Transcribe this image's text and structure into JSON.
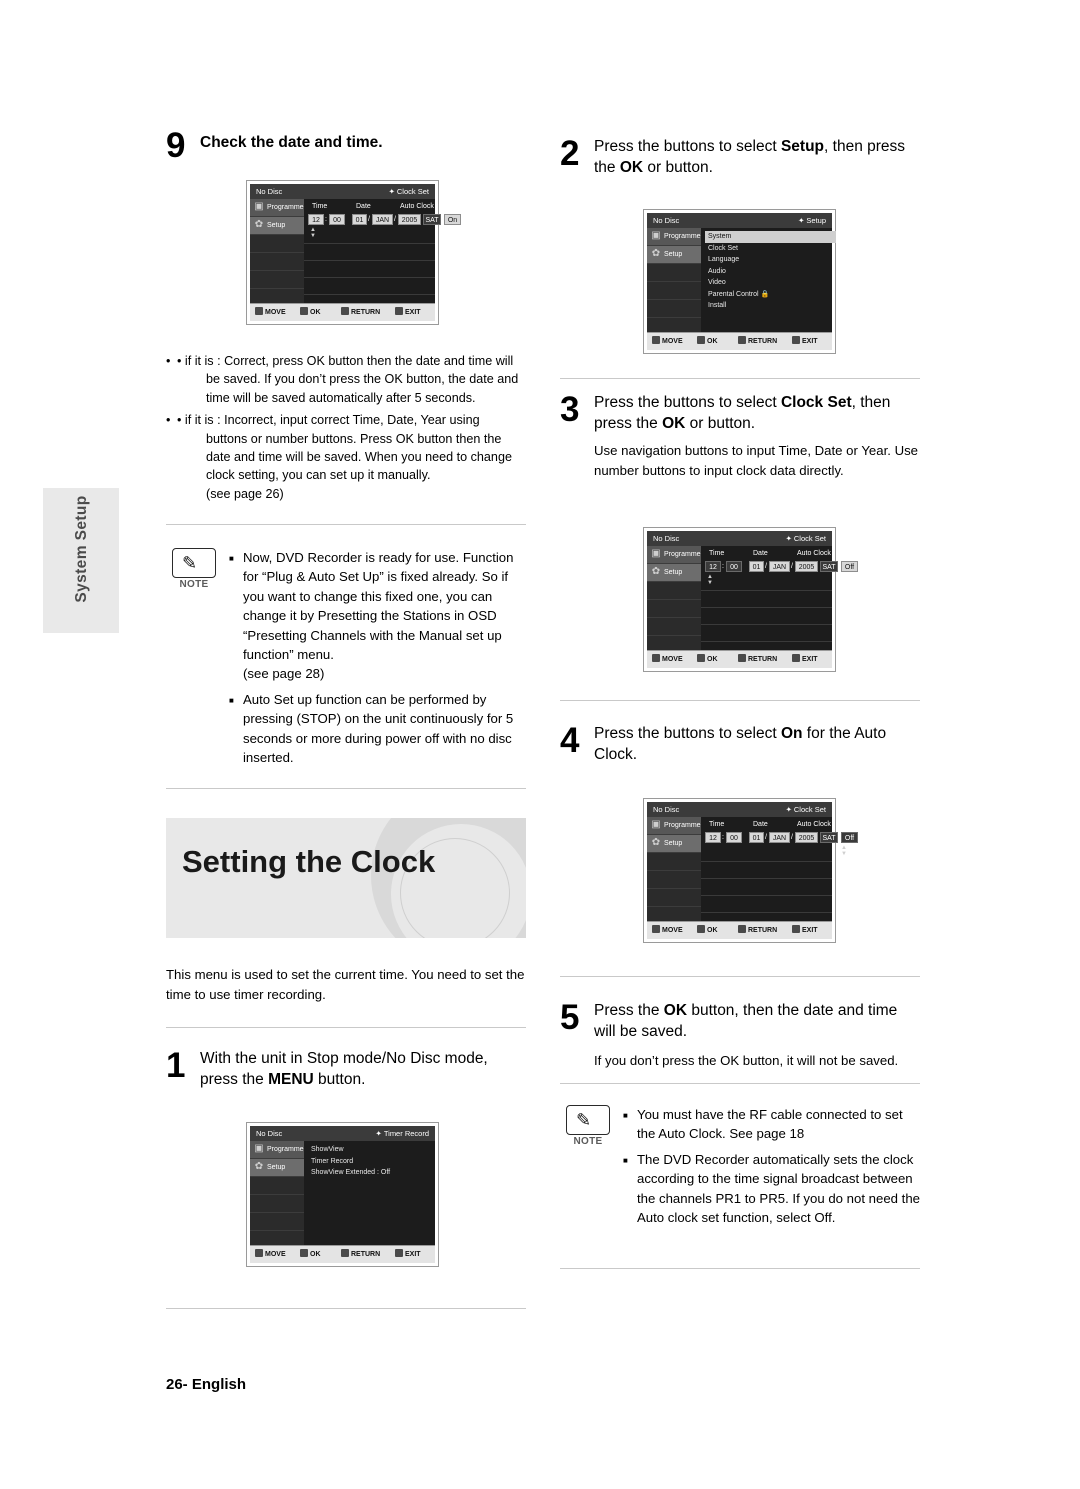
{
  "page": {
    "footer_page": "26-",
    "footer_lang": "English",
    "side_tab": "System Setup"
  },
  "left_column": {
    "step9": {
      "number": "9",
      "title": "Check the date and time."
    },
    "bullets": [
      {
        "lead": "• if it is : Correct, press OK button then the date and time will",
        "cont": "be saved. If you don’t press the OK button, the date and time will be saved automatically after 5 seconds."
      },
      {
        "lead": "• if it is : Incorrect, input correct Time, Date, Year using",
        "cont": "buttons or number buttons. Press OK button then the date and time will be saved. When you need to change clock setting, you can set up it manually.",
        "see": "(see page 26)"
      }
    ],
    "note": {
      "label": "NOTE",
      "items": [
        "Now, DVD Recorder is ready for use. Function for “Plug & Auto Set Up” is fixed already. So if you want to change this fixed one, you can change it by Presetting the Stations in OSD “Presetting Channels with the Manual set up function” menu.",
        "Auto Set up function can be performed by pressing     (STOP) on the unit continuously for 5 seconds or more during power off with no disc inserted."
      ],
      "see_page": "(see page 28)"
    },
    "banner_title": "Setting the Clock",
    "intro": "This menu is used to set the current time. You need to set the time to use timer recording.",
    "step1": {
      "number": "1",
      "text_pre": "With the unit in Stop mode/No Disc mode, press the ",
      "text_bold": "MENU",
      "text_post": " button."
    }
  },
  "right_column": {
    "step2": {
      "number": "2",
      "t1": "Press the      buttons to select ",
      "b1": "Setup",
      "t2": ", then press the ",
      "b2": "OK",
      "t3": " or     button."
    },
    "step3": {
      "number": "3",
      "t1": "Press the      buttons to select ",
      "b1": "Clock Set",
      "t2": ", then press the ",
      "b2": "OK",
      "t3": " or     button.",
      "body": "Use navigation            buttons to input Time, Date or Year. Use number buttons to input clock data directly."
    },
    "step4": {
      "number": "4",
      "t1": "Press the      buttons to select ",
      "b1": "On",
      "t2": " for the Auto Clock."
    },
    "step5": {
      "number": "5",
      "t1": "Press the ",
      "b1": "OK",
      "t2": " button, then the date and time will be saved.",
      "body": "If you don’t press the OK button, it will not be saved."
    },
    "note": {
      "label": "NOTE",
      "items": [
        "You must have the RF cable connected to set the Auto Clock. See page 18",
        "The DVD Recorder automatically sets the clock according to the time signal broadcast between the channels PR1 to PR5. If you do not need the Auto clock set function, select Off."
      ]
    }
  },
  "osd": {
    "common": {
      "no_disc": "No Disc",
      "side_programme": "Programme",
      "side_setup": "Setup",
      "buttons": [
        {
          "label": "MOVE"
        },
        {
          "label": "OK"
        },
        {
          "label": "RETURN"
        },
        {
          "label": "EXIT"
        }
      ]
    },
    "clock_set_1": {
      "title": "Clock Set",
      "headers": {
        "time": "Time",
        "date": "Date",
        "auto": "Auto Clock"
      },
      "time_hh": "12",
      "time_mm": "00",
      "date_dd": "01",
      "date_mon": "JAN",
      "date_yyyy": "2005",
      "weekday": "SAT",
      "auto_value": "On"
    },
    "setup_menu": {
      "title": "Setup",
      "items": [
        "System",
        "Clock Set",
        "Language",
        "Audio",
        "Video",
        "Parental Control",
        "Install"
      ],
      "highlighted": "System"
    },
    "clock_set_2": {
      "title": "Clock Set",
      "headers": {
        "time": "Time",
        "date": "Date",
        "auto": "Auto Clock"
      },
      "time_hh": "12",
      "time_mm": "00",
      "date_dd": "01",
      "date_mon": "JAN",
      "date_yyyy": "2005",
      "weekday": "SAT",
      "auto_value": "Off"
    },
    "clock_set_3": {
      "title": "Clock Set",
      "headers": {
        "time": "Time",
        "date": "Date",
        "auto": "Auto Clock"
      },
      "time_hh": "12",
      "time_mm": "00",
      "date_dd": "01",
      "date_mon": "JAN",
      "date_yyyy": "2005",
      "weekday": "SAT",
      "auto_value": "Off"
    },
    "timer_record": {
      "title": "Timer Record",
      "items": [
        "ShowView",
        "Timer Record",
        "ShowView Extended : Off"
      ]
    }
  }
}
